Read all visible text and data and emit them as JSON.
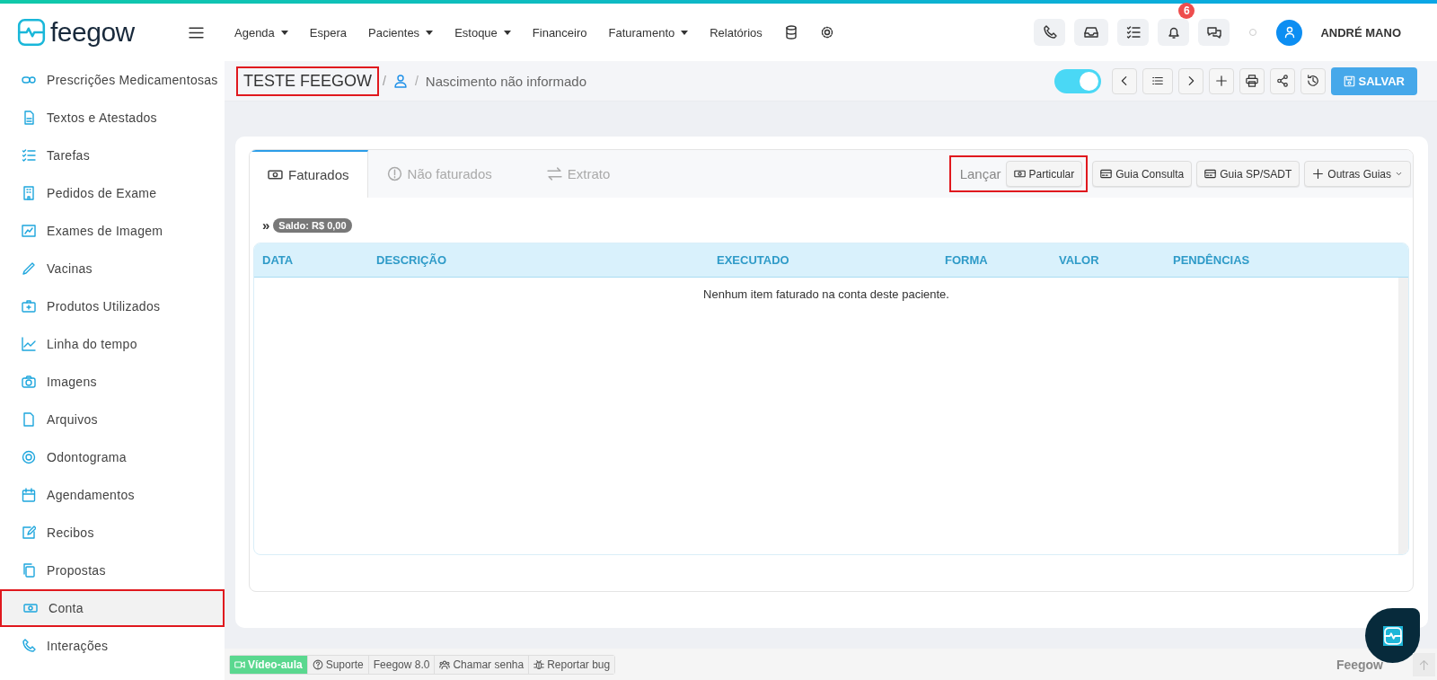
{
  "header": {
    "logo": "feegow",
    "menu": [
      {
        "label": "Agenda",
        "dropdown": true
      },
      {
        "label": "Espera",
        "dropdown": false
      },
      {
        "label": "Pacientes",
        "dropdown": true
      },
      {
        "label": "Estoque",
        "dropdown": true
      },
      {
        "label": "Financeiro",
        "dropdown": false
      },
      {
        "label": "Faturamento",
        "dropdown": true
      },
      {
        "label": "Relatórios",
        "dropdown": false
      }
    ],
    "notifications": "6",
    "user": "ANDRÉ MANO"
  },
  "sidebar": {
    "items": [
      {
        "label": "Prescrições Medicamentosas",
        "selected": false,
        "highlighted": false
      },
      {
        "label": "Textos e Atestados",
        "selected": false,
        "highlighted": false
      },
      {
        "label": "Tarefas",
        "selected": false,
        "highlighted": false
      },
      {
        "label": "Pedidos de Exame",
        "selected": false,
        "highlighted": false
      },
      {
        "label": "Exames de Imagem",
        "selected": false,
        "highlighted": false
      },
      {
        "label": "Vacinas",
        "selected": false,
        "highlighted": false
      },
      {
        "label": "Produtos Utilizados",
        "selected": false,
        "highlighted": false
      },
      {
        "label": "Linha do tempo",
        "selected": false,
        "highlighted": false
      },
      {
        "label": "Imagens",
        "selected": false,
        "highlighted": false
      },
      {
        "label": "Arquivos",
        "selected": false,
        "highlighted": false
      },
      {
        "label": "Odontograma",
        "selected": false,
        "highlighted": false
      },
      {
        "label": "Agendamentos",
        "selected": false,
        "highlighted": false
      },
      {
        "label": "Recibos",
        "selected": false,
        "highlighted": false
      },
      {
        "label": "Propostas",
        "selected": false,
        "highlighted": false
      },
      {
        "label": "Conta",
        "selected": true,
        "highlighted": true
      },
      {
        "label": "Interações",
        "selected": false,
        "highlighted": false
      }
    ]
  },
  "patient": {
    "name": "TESTE FEEGOW",
    "highlighted": true,
    "separator": "/",
    "breadcrumb_separator": "/",
    "birth": "Nascimento não informado",
    "toggle": {
      "on": true
    },
    "save": "SALVAR"
  },
  "tabs": [
    {
      "label": "Faturados",
      "selected": true
    },
    {
      "label": "Não faturados",
      "selected": false
    },
    {
      "label": "Extrato",
      "selected": false
    }
  ],
  "launch": {
    "label": "Lançar",
    "highlighted": true,
    "buttons": [
      {
        "label": "Particular",
        "dropdown": false
      },
      {
        "label": "Guia Consulta",
        "dropdown": false
      },
      {
        "label": "Guia SP/SADT",
        "dropdown": false
      },
      {
        "label": "Outras Guias",
        "dropdown": true
      }
    ]
  },
  "balance": {
    "marker": "»",
    "label": "Saldo: R$ 0,00"
  },
  "table": {
    "columns": [
      "DATA",
      "DESCRIÇÃO",
      "EXECUTADO",
      "FORMA",
      "VALOR",
      "PENDÊNCIAS"
    ],
    "empty": "Nenhum item faturado na conta deste paciente."
  },
  "footer": {
    "links": [
      {
        "label": "Vídeo-aula",
        "kind": "primary"
      },
      {
        "label": "Suporte",
        "kind": "plain"
      },
      {
        "label": "Feegow 8.0",
        "kind": "plain"
      },
      {
        "label": "Chamar senha",
        "kind": "plain"
      },
      {
        "label": "Reportar bug",
        "kind": "plain"
      }
    ],
    "brand": "Feegow"
  }
}
